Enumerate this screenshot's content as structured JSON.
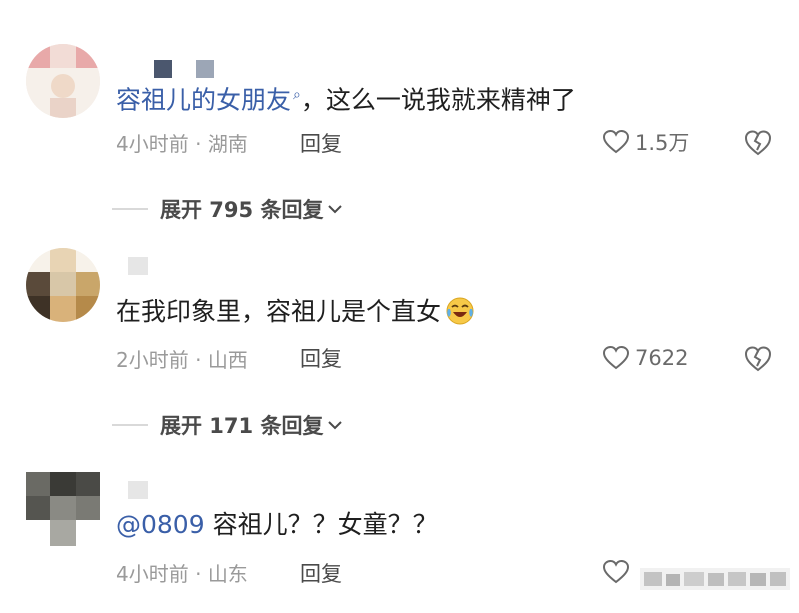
{
  "comments": [
    {
      "text_link": "容祖儿的女朋友",
      "text_rest": "，这么一说我就来精神了",
      "time": "4小时前",
      "location": "湖南",
      "reply": "回复",
      "likes": "1.5万",
      "expand": "展开 795 条回复"
    },
    {
      "text": "在我印象里，容祖儿是个直女",
      "time": "2小时前",
      "location": "山西",
      "reply": "回复",
      "likes": "7622",
      "expand": "展开 171 条回复"
    },
    {
      "mention": "@0809",
      "text": " 容祖儿？？女童？？",
      "time": "4小时前",
      "location": "山东",
      "reply": "回复"
    }
  ],
  "icons": {
    "like": "heart-outline-icon",
    "dislike": "broken-heart-outline-icon",
    "expand": "chevron-down-icon",
    "search": "search-icon",
    "emoji": "crying-laughing-emoji-icon"
  },
  "colors": {
    "link": "#3a5fa8",
    "meta": "#9a9a9a",
    "text": "#1f1f1f"
  }
}
